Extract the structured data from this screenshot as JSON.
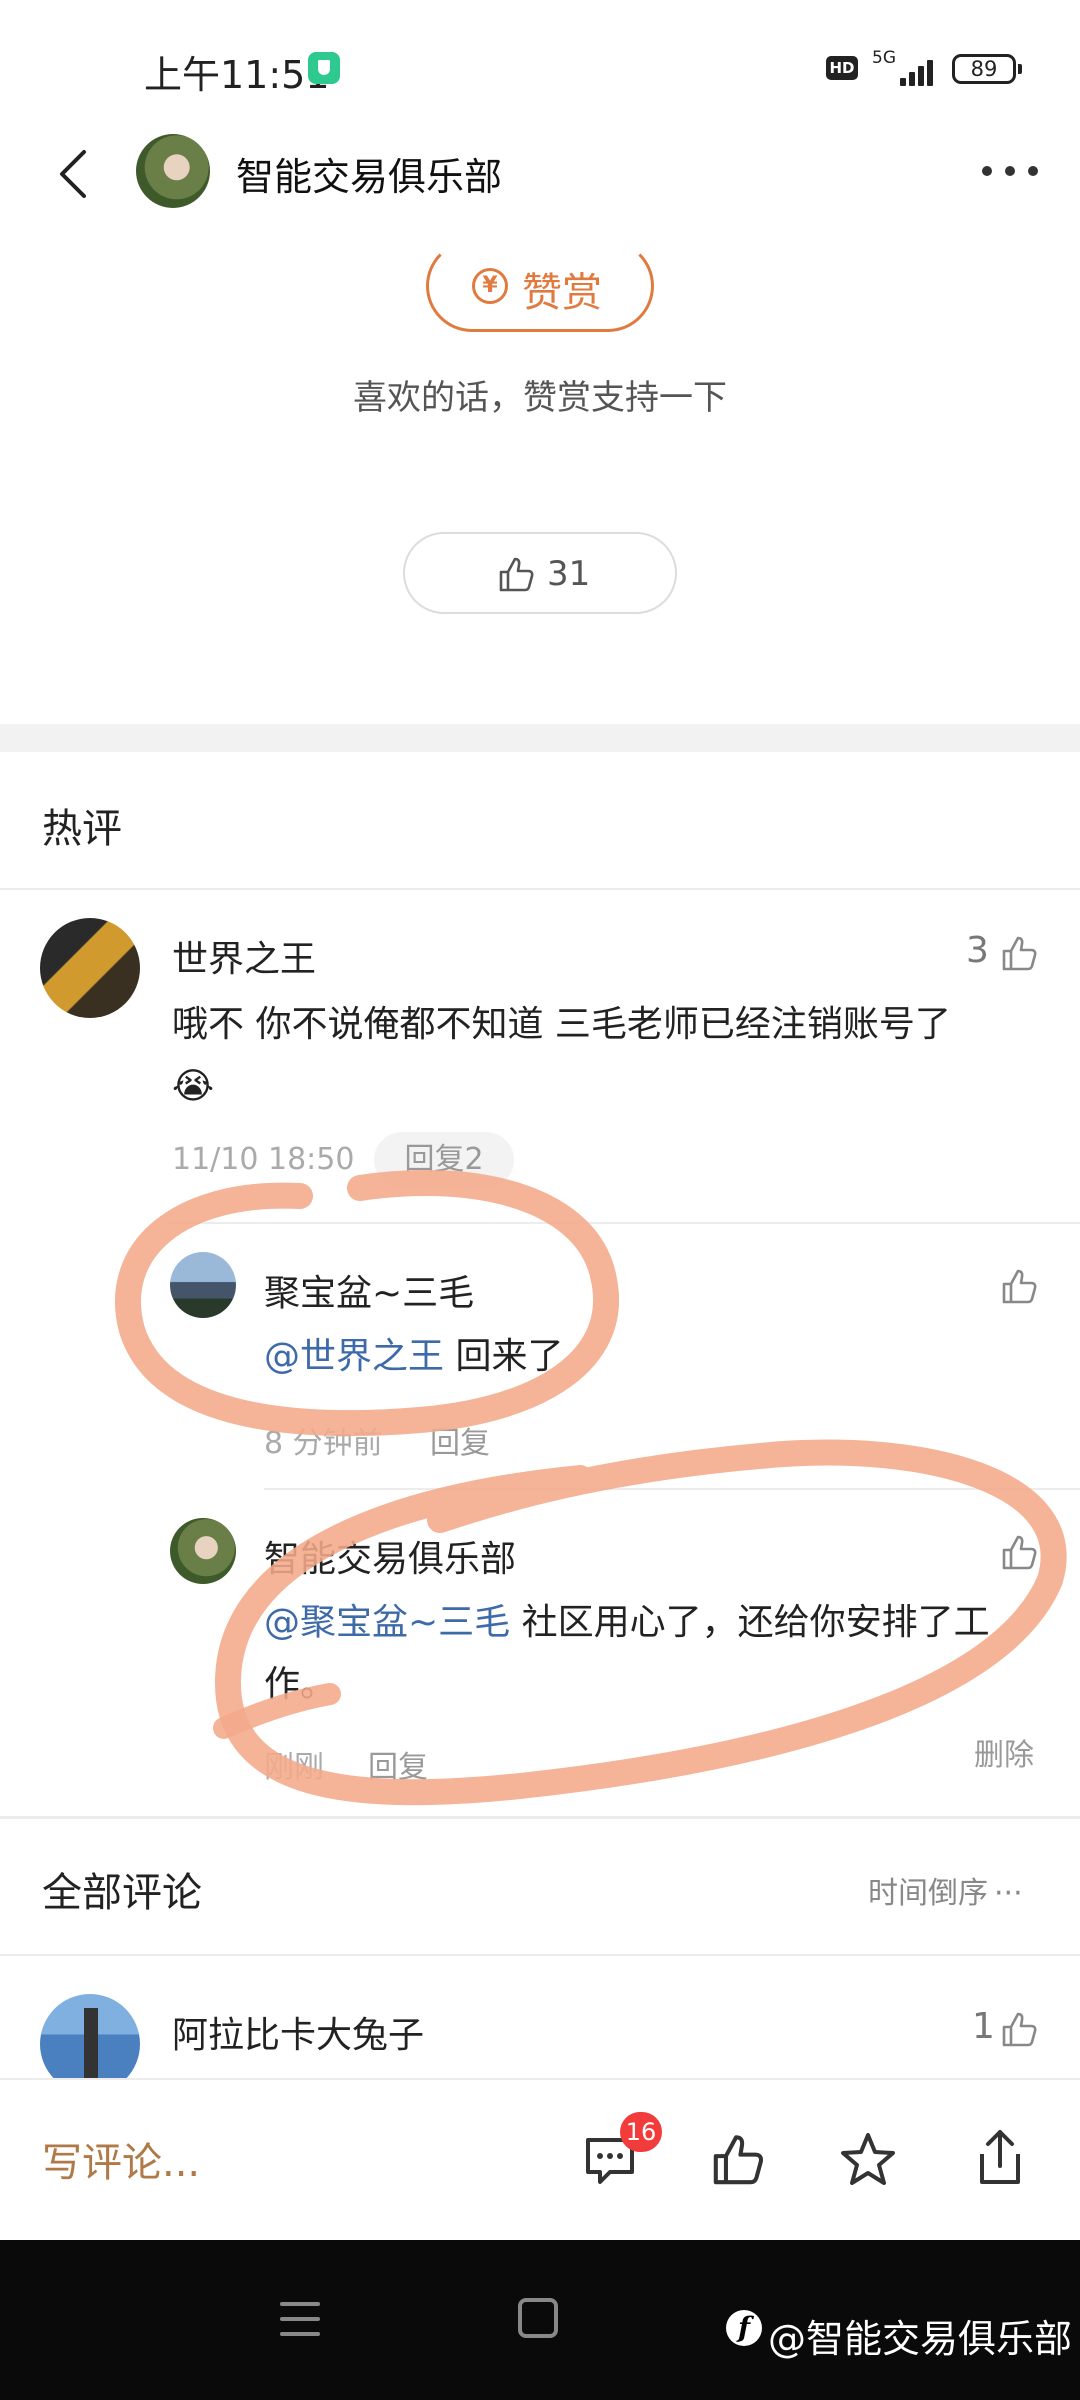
{
  "status_bar": {
    "time": "上午11:51",
    "hd": "HD",
    "network": "5G",
    "battery": "89"
  },
  "header": {
    "title": "智能交易俱乐部"
  },
  "reward": {
    "button_label": "赞赏",
    "hint": "喜欢的话，赞赏支持一下"
  },
  "article_like_count": "31",
  "hot_comments": {
    "title": "热评",
    "items": [
      {
        "author": "世界之王",
        "likes": "3",
        "text": "哦不 你不说俺都不知道 三毛老师已经注销账号了",
        "emoji": "😭",
        "time": "11/10 18:50",
        "reply_label": "回复2"
      }
    ],
    "replies": [
      {
        "author": "聚宝盆~三毛",
        "mention": "@世界之王",
        "text": " 回来了",
        "time": "8 分钟前",
        "reply_label": "回复"
      },
      {
        "author": "智能交易俱乐部",
        "mention": "@聚宝盆~三毛",
        "text": " 社区用心了，还给你安排了工作。",
        "time": "刚刚",
        "reply_label": "回复",
        "delete_label": "删除"
      }
    ]
  },
  "all_comments": {
    "title": "全部评论",
    "sort_label": "时间倒序",
    "items": [
      {
        "author": "阿拉比卡大兔子",
        "likes": "1"
      }
    ]
  },
  "bottom_bar": {
    "placeholder": "写评论...",
    "comment_badge": "16"
  },
  "watermark": "@智能交易俱乐部",
  "colors": {
    "accent": "#e07a3f",
    "mention": "#3e6aa8",
    "annotation": "#f4a88a",
    "badge": "#f23b3b"
  }
}
